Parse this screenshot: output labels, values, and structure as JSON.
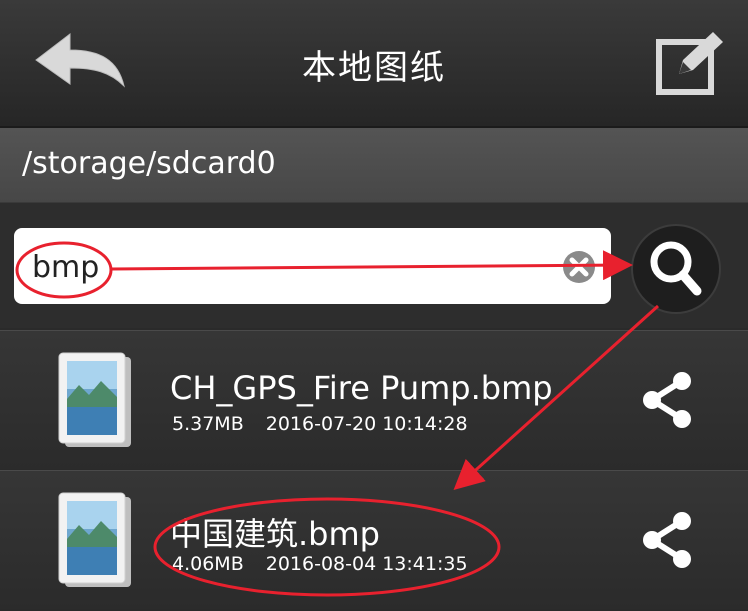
{
  "header": {
    "title": "本地图纸",
    "back_icon": "back-arrow-icon",
    "edit_icon": "edit-icon"
  },
  "path": "/storage/sdcard0",
  "search": {
    "value": "bmp",
    "clear_icon": "clear-icon",
    "search_icon": "search-icon"
  },
  "files": [
    {
      "name": "CH_GPS_Fire Pump.bmp",
      "size": "5.37MB",
      "date": "2016-07-20 10:14:28"
    },
    {
      "name": "中国建筑.bmp",
      "size": "4.06MB",
      "date": "2016-08-04 13:41:35"
    }
  ],
  "colors": {
    "annotation": "#e8212e",
    "background": "#2a2a2a"
  }
}
